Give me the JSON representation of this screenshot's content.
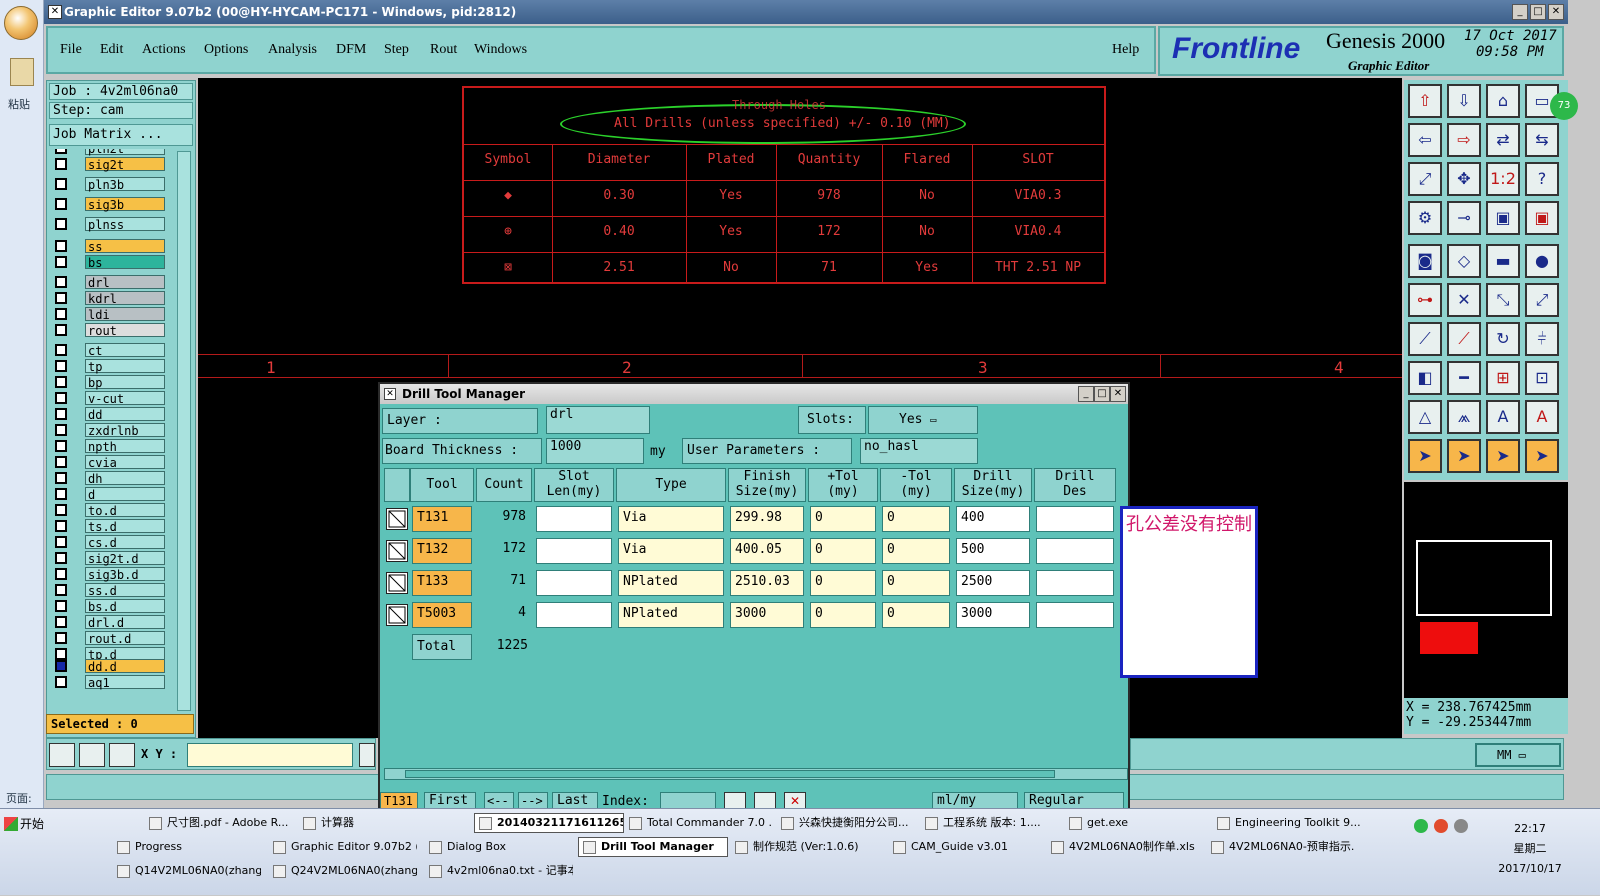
{
  "office": {
    "paste_label": "粘贴",
    "page_label": "页面:"
  },
  "window": {
    "title": "Graphic Editor 9.07b2 (00@HY-HYCAM-PC171 - Windows, pid:2812)"
  },
  "menu": {
    "items": [
      "File",
      "Edit",
      "Actions",
      "Options",
      "Analysis",
      "DFM",
      "Step",
      "Rout",
      "Windows"
    ],
    "help": "Help"
  },
  "brand": {
    "logo": "Frontline",
    "product": "Genesis 2000",
    "subtitle": "Graphic Editor",
    "date": "17 Oct 2017",
    "time": "09:58 PM"
  },
  "left": {
    "job": "Job  : 4v2ml06na0",
    "step": "Step: cam",
    "job_matrix": "Job Matrix ...",
    "layers": [
      {
        "name": "pln2t",
        "color": "#a9e2de"
      },
      {
        "name": "sig2t",
        "color": "#f6c046"
      },
      {
        "name": "pln3b",
        "color": "#a9e2de"
      },
      {
        "name": "sig3b",
        "color": "#f6c046"
      },
      {
        "name": "plnss",
        "color": "#a9e2de"
      },
      {
        "name": "ss",
        "color": "#f6c046"
      },
      {
        "name": "bs",
        "color": "#2db49c"
      },
      {
        "name": "drl",
        "color": "#b8c0c4"
      },
      {
        "name": "kdrl",
        "color": "#b8c0c4"
      },
      {
        "name": "ldi",
        "color": "#b8c0c4"
      },
      {
        "name": "rout",
        "color": "#dddddd"
      },
      {
        "name": "ct",
        "color": "#a9e2de"
      },
      {
        "name": "tp",
        "color": "#a9e2de"
      },
      {
        "name": "bp",
        "color": "#a9e2de"
      },
      {
        "name": "v-cut",
        "color": "#a9e2de"
      },
      {
        "name": "dd",
        "color": "#a9e2de"
      },
      {
        "name": "zxdrlnb",
        "color": "#a9e2de"
      },
      {
        "name": "npth",
        "color": "#a9e2de"
      },
      {
        "name": "cvia",
        "color": "#a9e2de"
      },
      {
        "name": "dh",
        "color": "#a9e2de"
      },
      {
        "name": "d",
        "color": "#a9e2de"
      },
      {
        "name": "to.d",
        "color": "#a9e2de"
      },
      {
        "name": "ts.d",
        "color": "#a9e2de"
      },
      {
        "name": "cs.d",
        "color": "#a9e2de"
      },
      {
        "name": "sig2t.d",
        "color": "#a9e2de"
      },
      {
        "name": "sig3b.d",
        "color": "#a9e2de"
      },
      {
        "name": "ss.d",
        "color": "#a9e2de"
      },
      {
        "name": "bs.d",
        "color": "#a9e2de"
      },
      {
        "name": "drl.d",
        "color": "#a9e2de"
      },
      {
        "name": "rout.d",
        "color": "#a9e2de"
      },
      {
        "name": "tp.d",
        "color": "#a9e2de"
      },
      {
        "name": "dd.d",
        "color": "#f6c046"
      },
      {
        "name": "aq1",
        "color": "#a9e2de"
      }
    ],
    "selected": "Selected : 0",
    "xy_label": "X Y :"
  },
  "canvas": {
    "table_title": "Through Holes",
    "table_subtitle": "All Drills (unless specified) +/- 0.10 (MM)",
    "headers": [
      "Symbol",
      "Diameter",
      "Plated",
      "Quantity",
      "Flared",
      "SLOT"
    ],
    "rows": [
      [
        "◆",
        "0.30",
        "Yes",
        "978",
        "No",
        "VIA0.3"
      ],
      [
        "⊕",
        "0.40",
        "Yes",
        "172",
        "No",
        "VIA0.4"
      ],
      [
        "⊠",
        "2.51",
        "No",
        "71",
        "Yes",
        "THT 2.51 NP"
      ]
    ],
    "ruler": [
      "1",
      "2",
      "3",
      "4"
    ]
  },
  "coords": {
    "x": "X = 238.767425mm",
    "y": "Y = -29.253447mm",
    "units": "MM"
  },
  "dialog": {
    "title": "Drill Tool Manager",
    "layer_label": "Layer          :",
    "layer_value": "drl",
    "slots_label": "Slots:",
    "slots_value": "Yes",
    "thickness_label": "Board Thickness :",
    "thickness_value": "1000",
    "thickness_unit": "my",
    "user_params_label": "User Parameters :",
    "user_params_value": "no_hasl",
    "columns": [
      {
        "l1": "Tool",
        "l2": ""
      },
      {
        "l1": "Count",
        "l2": ""
      },
      {
        "l1": "Slot",
        "l2": "Len(my)"
      },
      {
        "l1": "Type",
        "l2": ""
      },
      {
        "l1": "Finish",
        "l2": "Size(my)"
      },
      {
        "l1": "+Tol",
        "l2": "(my)"
      },
      {
        "l1": "-Tol",
        "l2": "(my)"
      },
      {
        "l1": "Drill",
        "l2": "Size(my)"
      },
      {
        "l1": "Drill",
        "l2": "Des"
      }
    ],
    "tools": [
      {
        "tool": "T131",
        "count": "978",
        "slot": "",
        "type": "Via",
        "finish": "299.98",
        "ptol": "0",
        "ntol": "0",
        "drill": "400",
        "des": ""
      },
      {
        "tool": "T132",
        "count": "172",
        "slot": "",
        "type": "Via",
        "finish": "400.05",
        "ptol": "0",
        "ntol": "0",
        "drill": "500",
        "des": ""
      },
      {
        "tool": "T133",
        "count": "71",
        "slot": "",
        "type": "NPlated",
        "finish": "2510.03",
        "ptol": "0",
        "ntol": "0",
        "drill": "2500",
        "des": ""
      },
      {
        "tool": "T5003",
        "count": "4",
        "slot": "",
        "type": "NPlated",
        "finish": "3000",
        "ptol": "0",
        "ntol": "0",
        "drill": "3000",
        "des": ""
      }
    ],
    "total_label": "Total",
    "total_count": "1225",
    "bottom": {
      "tool": "T131",
      "first": "First",
      "prev": "<--",
      "next": "-->",
      "last": "Last",
      "index": "Index:",
      "units": "ml/my",
      "mode": "Regular"
    }
  },
  "note": "孔公差没有控制",
  "taskbar": {
    "start": "开始",
    "row1": [
      "尺寸图.pdf - Adobe R...",
      "计算器",
      "20140321171611265...",
      "Total Commander 7.0 ...",
      "兴森快捷衡阳分公司...",
      "工程系统  版本: 1....",
      "get.exe",
      "Engineering Toolkit 9...."
    ],
    "row2": [
      "Progress",
      "Graphic Editor 9.07b2 (0...",
      "Dialog Box",
      "Drill Tool Manager",
      "制作规范 (Ver:1.0.6)",
      "CAM_Guide v3.01",
      "4V2ML06NA0制作单.xls...",
      "4V2ML06NA0-预审指示..."
    ],
    "row3": [
      "Q14V2ML06NA0(zhangy...",
      "Q24V2ML06NA0(zhangy...",
      "4v2ml06na0.txt - 记事本"
    ],
    "clock_time": "22:17",
    "clock_day": "星期二",
    "clock_date": "2017/10/17"
  }
}
